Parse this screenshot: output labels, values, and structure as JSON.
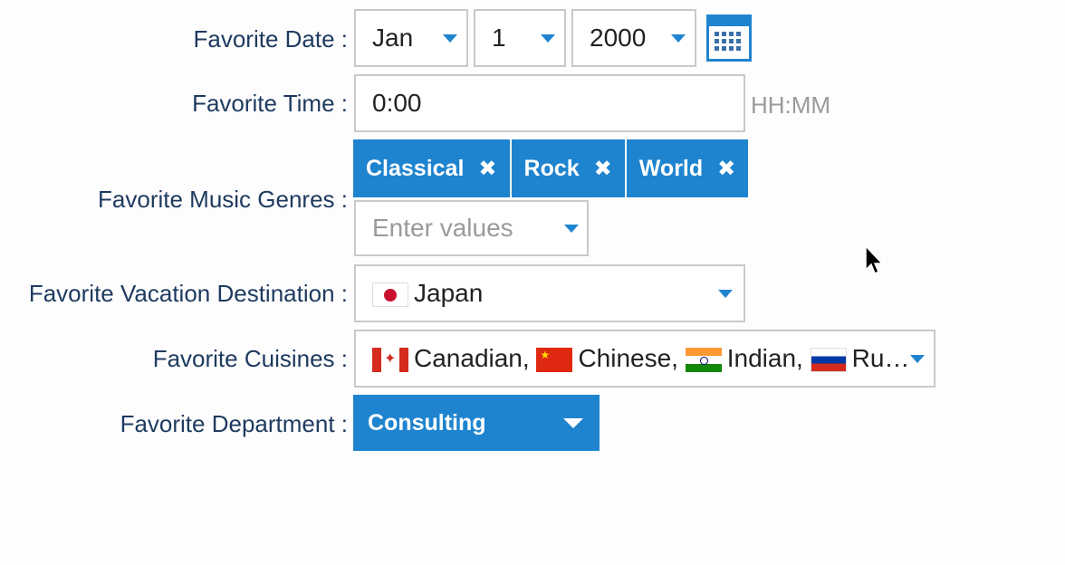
{
  "labels": {
    "date": "Favorite Date :",
    "time": "Favorite Time :",
    "music": "Favorite Music Genres :",
    "vacation": "Favorite Vacation Destination :",
    "cuisines": "Favorite Cuisines :",
    "department": "Favorite Department :"
  },
  "date": {
    "month": "Jan",
    "day": "1",
    "year": "2000",
    "calendar_icon": "calendar-icon"
  },
  "time": {
    "value": "0:00",
    "format_hint": "HH:MM"
  },
  "music": {
    "tags": [
      "Classical",
      "Rock",
      "World"
    ],
    "remove_glyph": "✖",
    "placeholder": "Enter values"
  },
  "vacation": {
    "value": "Japan",
    "flag": "japan-flag-icon"
  },
  "cuisines": {
    "items": [
      "Canadian,",
      "Chinese,",
      "Indian,",
      "Ru…"
    ],
    "flags": [
      "canada-flag-icon",
      "china-flag-icon",
      "india-flag-icon",
      "russia-flag-icon"
    ]
  },
  "department": {
    "value": "Consulting"
  },
  "colors": {
    "accent": "#1f84cf",
    "label_text": "#1e3a5f",
    "border": "#c9c9c9",
    "hint": "#9a9a9a"
  }
}
